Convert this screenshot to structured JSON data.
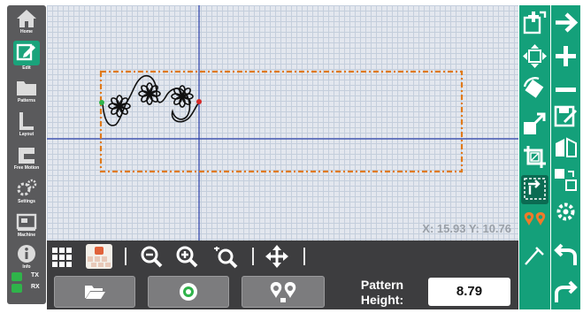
{
  "sidebar": {
    "items": [
      {
        "label": "Home",
        "icon": "home-icon"
      },
      {
        "label": "Edit",
        "icon": "edit-icon",
        "active": true
      },
      {
        "label": "Patterns",
        "icon": "folder-icon"
      },
      {
        "label": "Layout",
        "icon": "layout-icon"
      },
      {
        "label": "Free Motion",
        "icon": "free-motion-icon"
      },
      {
        "label": "Settings",
        "icon": "settings-icon"
      },
      {
        "label": "Machine",
        "icon": "machine-icon"
      },
      {
        "label": "Info",
        "icon": "info-icon"
      }
    ],
    "status": [
      {
        "label": "TX",
        "color": "#2fb34a"
      },
      {
        "label": "RX",
        "color": "#2fb34a"
      }
    ]
  },
  "canvas": {
    "coord_readout": "X: 15.93 Y: 10.76",
    "boundary_color": "#e07a1a",
    "crosshair_color": "#2a3fa8",
    "start_marker_color": "#2fb34a",
    "end_marker_color": "#d62828"
  },
  "toolbar": {
    "tools": [
      "grid-view-icon",
      "quilt-preview-icon",
      "zoom-out-icon",
      "zoom-in-icon",
      "zoom-fit-icon",
      "pan-icon"
    ]
  },
  "actions": {
    "buttons": [
      "folder-open-icon",
      "needle-position-icon",
      "set-points-icon"
    ],
    "pattern_height_label": "Pattern Height:",
    "pattern_height_value": "8.79"
  },
  "right_tools": [
    "add-pattern-icon",
    "move-pattern-icon",
    "rotate-icon",
    "resize-icon",
    "crop-icon",
    "align-icon",
    "start-end-points-icon",
    "measure-icon"
  ],
  "right_nav": [
    "next-arrow-icon",
    "add-icon",
    "remove-icon",
    "save-icon",
    "mirror-icon",
    "repeat-icon",
    "settings-gear-icon",
    "undo-icon",
    "redo-icon"
  ],
  "colors": {
    "sidebar": "#5a5a5c",
    "accent_green": "#14a07a",
    "bottom_bar": "#3d3d3f"
  }
}
